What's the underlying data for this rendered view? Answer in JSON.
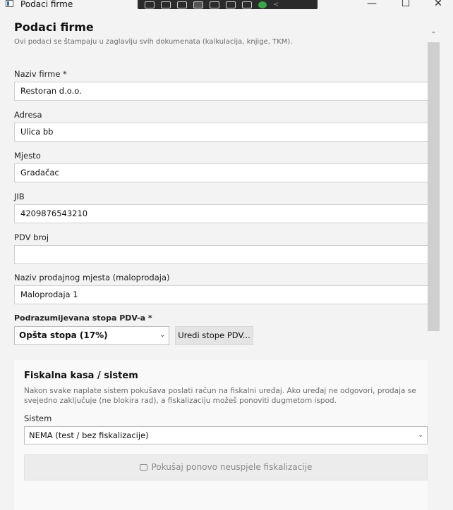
{
  "window": {
    "title": "Podaci firme",
    "minimize": "—",
    "maximize": "☐",
    "close": "✕"
  },
  "form": {
    "title": "Podaci firme",
    "subtitle": "Ovi podaci se štampaju u zaglavlju svih dokumenata (kalkulacija, knjige, TKM).",
    "naziv": {
      "label": "Naziv firme *",
      "value": "Restoran d.o.o."
    },
    "adresa": {
      "label": "Adresa",
      "value": "Ulica bb"
    },
    "mjesto": {
      "label": "Mjesto",
      "value": "Gradačac"
    },
    "jib": {
      "label": "JIB",
      "value": "4209876543210"
    },
    "pdv_broj": {
      "label": "PDV broj",
      "value": ""
    },
    "prodajno_mjesto": {
      "label": "Naziv prodajnog mjesta (maloprodaja)",
      "value": "Maloprodaja 1"
    },
    "stopa": {
      "label": "Podrazumijevana stopa PDV-a *",
      "value": "Opšta stopa (17%)"
    },
    "uredi_button": "Uredi stope PDV..."
  },
  "fiscal": {
    "title": "Fiskalna kasa / sistem",
    "description": "Nakon svake naplate sistem pokušava poslati račun na fiskalni uređaj. Ako uređaj ne odgovori, prodaja se svejedno zaključuje (ne blokira rad), a fiskalizaciju možeš ponoviti dugmetom ispod.",
    "sistem_label": "Sistem",
    "sistem_value": "NEMA (test / bez fiskalizacije)",
    "retry_button": "Pokušaj ponovo neuspjele fiskalizacije"
  }
}
